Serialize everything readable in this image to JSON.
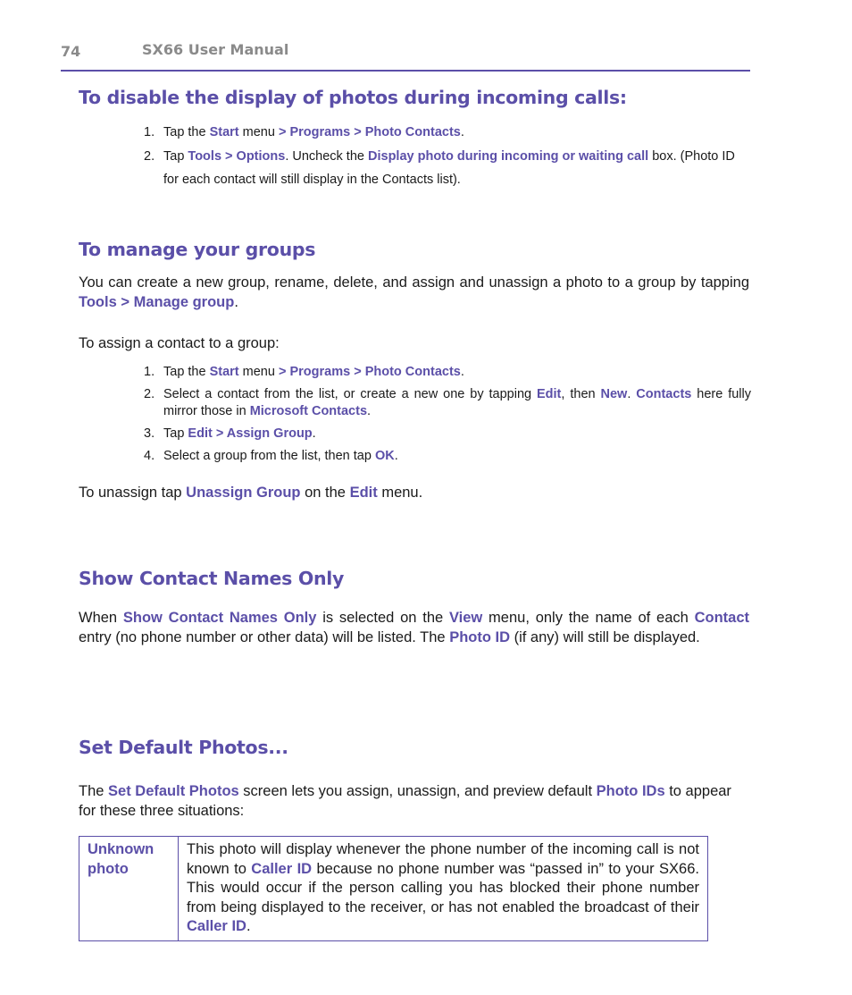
{
  "header": {
    "page_number": "74",
    "manual_title": "SX66 User Manual"
  },
  "section1": {
    "title": "To disable the display of photos during incoming calls:",
    "steps": [
      {
        "num": "1.",
        "t1": "Tap the ",
        "h1": "Start",
        "t2": " menu ",
        "h2": "> Programs > Photo Contacts",
        "t3": "."
      },
      {
        "num": "2.",
        "t1": "Tap ",
        "h1": "Tools > Options",
        "t2": ". Uncheck the ",
        "h2": "Display photo during incoming or waiting call",
        "t3": " box. (Photo ID for each contact will still display in the Contacts list)."
      }
    ]
  },
  "section2": {
    "title": "To manage your groups",
    "intro": {
      "t1": "You can create a new group, rename, delete, and assign and unassign a photo to a group by tapping ",
      "h1": "Tools > Manage group",
      "t2": "."
    },
    "assign_intro": "To assign a contact to a group:",
    "steps": [
      {
        "num": "1.",
        "t1": "Tap the ",
        "h1": "Start",
        "t2": " menu ",
        "h2": "> Programs > Photo Contacts",
        "t3": "."
      },
      {
        "num": "2.",
        "t1": "Select a contact from the list, or create a new one by tapping ",
        "h1": "Edit",
        "t2": ", then ",
        "h2": "New",
        "t3": ". ",
        "h3": "Contacts",
        "t4": " here fully mirror those in ",
        "h4": "Microsoft Contacts",
        "t5": "."
      },
      {
        "num": "3.",
        "t1": "Tap ",
        "h1": "Edit > Assign Group",
        "t2": "."
      },
      {
        "num": "4.",
        "t1": "Select a group from the list, then tap ",
        "h1": "OK",
        "t2": "."
      }
    ],
    "unassign": {
      "t1": "To unassign tap ",
      "h1": "Unassign Group",
      "t2": " on the ",
      "h2": "Edit",
      "t3": " menu."
    }
  },
  "section3": {
    "title": "Show Contact Names Only",
    "body": {
      "t1": "When ",
      "h1": "Show Contact Names Only",
      "t2": " is selected on the ",
      "h2": "View",
      "t3": " menu, only the name of each ",
      "h3": "Contact",
      "t4": " entry (no phone number or other data) will be listed. The ",
      "h4": "Photo ID",
      "t5": " (if any) will still be displayed."
    }
  },
  "section4": {
    "title": "Set Default Photos...",
    "body": {
      "t1": "The ",
      "h1": "Set Default Photos",
      "t2": " screen lets you assign, unassign, and preview default ",
      "h2": "Photo IDs",
      "t3": " to appear for these three situations:"
    },
    "table_rows": [
      {
        "label": "Unknown photo",
        "t1": "This photo will display whenever the phone number of the incoming call is not known to ",
        "h1": "Caller ID",
        "t2": " because no phone number was “passed in” to your SX66. This would occur if the person calling you has blocked their phone number from being displayed to the receiver, or has not enabled the broadcast of their ",
        "h2": "Caller ID",
        "t3": "."
      }
    ]
  },
  "colors": {
    "accent": "#5b4fa8",
    "header_text": "#8a8a8a",
    "body_text": "#1a1a1a"
  }
}
